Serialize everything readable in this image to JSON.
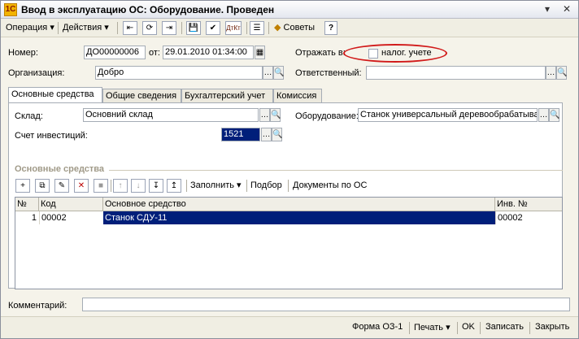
{
  "window": {
    "title": "Ввод в эксплуатацию ОС: Оборудование. Проведен",
    "app_icon_glyph": "1С",
    "controls": {
      "menu": "▾",
      "close": "✕"
    }
  },
  "toolbar": {
    "operation_label": "Операция ▾",
    "actions_label": "Действия ▾",
    "tips_label": "Советы",
    "help_label": "?",
    "icon_back": "⇤",
    "icon_refresh": "⟳",
    "icon_forward": "⇥",
    "icon_save": "💾",
    "icon_post": "✔",
    "icon_dt_kt": "ДтКт",
    "icon_report": "☰"
  },
  "form": {
    "number_label": "Номер:",
    "number_value": "ДО00000006",
    "from_label": "от:",
    "date_value": "29.01.2010 01:34:00",
    "reflect_label": "Отражать в:",
    "tax_accounting_label": "налог. учете",
    "organization_label": "Организация:",
    "organization_value": "Добро",
    "responsible_label": "Ответственный:",
    "responsible_value": ""
  },
  "tabs": [
    {
      "label": "Основные средства"
    },
    {
      "label": "Общие сведения"
    },
    {
      "label": "Бухгалтерский учет"
    },
    {
      "label": "Комиссия"
    }
  ],
  "tab_main": {
    "warehouse_label": "Склад:",
    "warehouse_value": "Основний склад",
    "equipment_label": "Оборудование:",
    "equipment_value": "Станок универсальный деревообрабатыва",
    "investment_account_label": "Счет инвестиций:",
    "investment_account_value": "1521",
    "section_title": "Основные средства"
  },
  "table_toolbar": {
    "fill_label": "Заполнить ▾",
    "selection_label": "Подбор",
    "documents_label": "Документы по ОС"
  },
  "table": {
    "columns": [
      "№",
      "Код",
      "Основное средство",
      "Инв. №"
    ],
    "rows": [
      {
        "n": "1",
        "code": "00002",
        "asset": "Станок СДУ-11",
        "inv": "00002"
      }
    ]
  },
  "comment": {
    "label": "Комментарий:",
    "value": ""
  },
  "bottom": {
    "form_label": "Форма ОЗ-1",
    "print_label": "Печать ▾",
    "ok_label": "OK",
    "save_label": "Записать",
    "close_label": "Закрыть"
  },
  "accent": {
    "selection": "#001f7a",
    "annotation": "#d11a1a"
  }
}
